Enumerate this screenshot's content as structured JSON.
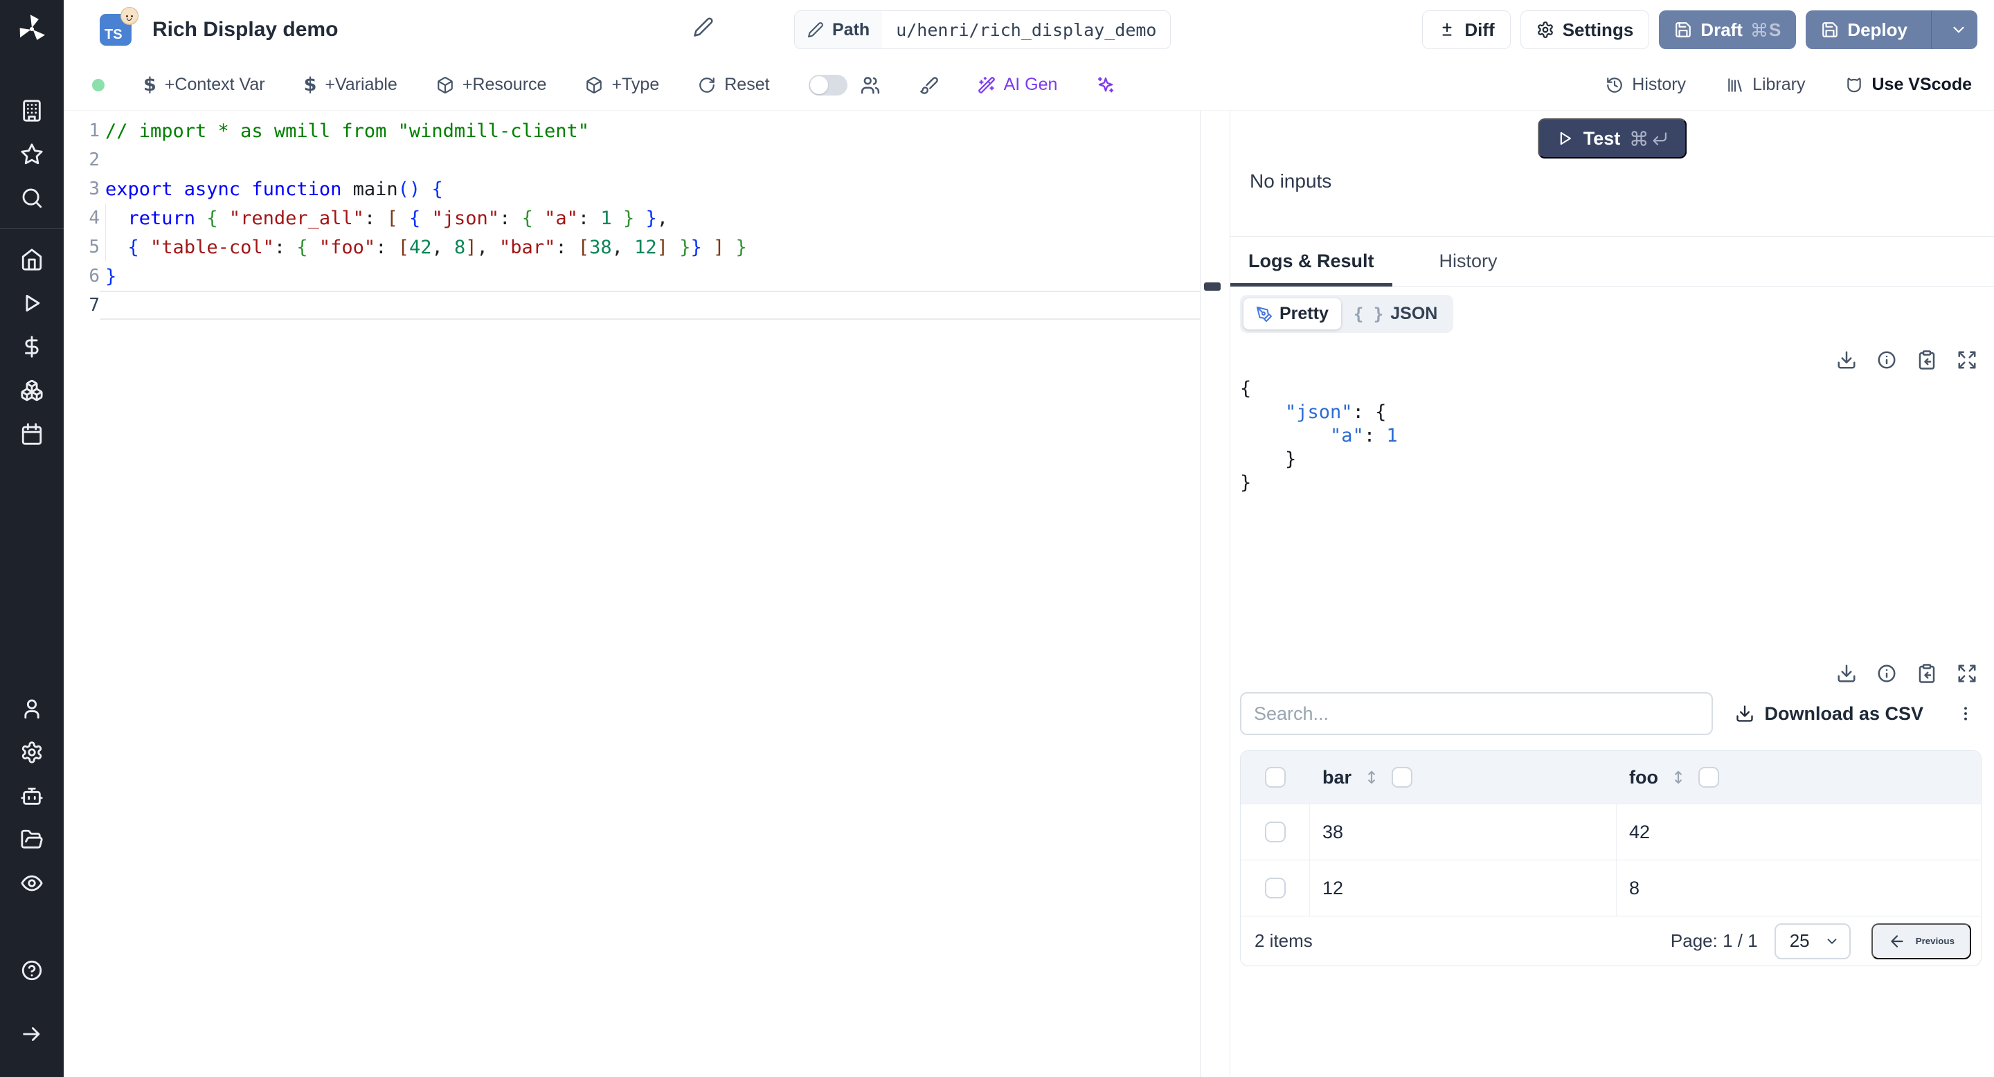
{
  "header": {
    "badge": "TS",
    "title": "Rich Display demo",
    "path_label": "Path",
    "path_value": "u/henri/rich_display_demo",
    "diff": "Diff",
    "settings": "Settings",
    "draft": "Draft",
    "draft_shortcut": "S",
    "deploy": "Deploy"
  },
  "toolbar": {
    "status_dot_color": "#8be0ac",
    "context_var": "+Context Var",
    "variable": "+Variable",
    "resource": "+Resource",
    "type": "+Type",
    "reset": "Reset",
    "ai_gen": "AI Gen",
    "history": "History",
    "library": "Library",
    "use_vscode": "Use VScode"
  },
  "editor": {
    "lines": [
      {
        "n": 1,
        "toks": [
          {
            "c": "c",
            "t": "// import * as wmill from \"windmill-client\""
          }
        ]
      },
      {
        "n": 2,
        "toks": []
      },
      {
        "n": 3,
        "toks": [
          {
            "c": "k",
            "t": "export async function "
          },
          {
            "c": "p",
            "t": "main"
          },
          {
            "c": "b1",
            "t": "()"
          },
          {
            "c": "p",
            "t": " "
          },
          {
            "c": "b1",
            "t": "{"
          }
        ]
      },
      {
        "n": 4,
        "toks": [
          {
            "c": "p",
            "t": "  "
          },
          {
            "c": "k",
            "t": "return"
          },
          {
            "c": "p",
            "t": " "
          },
          {
            "c": "b2",
            "t": "{"
          },
          {
            "c": "p",
            "t": " "
          },
          {
            "c": "s",
            "t": "\"render_all\""
          },
          {
            "c": "p",
            "t": ": "
          },
          {
            "c": "b3",
            "t": "["
          },
          {
            "c": "p",
            "t": " "
          },
          {
            "c": "b1",
            "t": "{"
          },
          {
            "c": "p",
            "t": " "
          },
          {
            "c": "s",
            "t": "\"json\""
          },
          {
            "c": "p",
            "t": ": "
          },
          {
            "c": "b2",
            "t": "{"
          },
          {
            "c": "p",
            "t": " "
          },
          {
            "c": "s",
            "t": "\"a\""
          },
          {
            "c": "p",
            "t": ": "
          },
          {
            "c": "n",
            "t": "1"
          },
          {
            "c": "p",
            "t": " "
          },
          {
            "c": "b2",
            "t": "}"
          },
          {
            "c": "p",
            "t": " "
          },
          {
            "c": "b1",
            "t": "}"
          },
          {
            "c": "p",
            "t": ","
          }
        ]
      },
      {
        "n": 5,
        "toks": [
          {
            "c": "p",
            "t": "  "
          },
          {
            "c": "b1",
            "t": "{"
          },
          {
            "c": "p",
            "t": " "
          },
          {
            "c": "s",
            "t": "\"table-col\""
          },
          {
            "c": "p",
            "t": ": "
          },
          {
            "c": "b2",
            "t": "{"
          },
          {
            "c": "p",
            "t": " "
          },
          {
            "c": "s",
            "t": "\"foo\""
          },
          {
            "c": "p",
            "t": ": "
          },
          {
            "c": "b3",
            "t": "["
          },
          {
            "c": "n",
            "t": "42"
          },
          {
            "c": "p",
            "t": ", "
          },
          {
            "c": "n",
            "t": "8"
          },
          {
            "c": "b3",
            "t": "]"
          },
          {
            "c": "p",
            "t": ", "
          },
          {
            "c": "s",
            "t": "\"bar\""
          },
          {
            "c": "p",
            "t": ": "
          },
          {
            "c": "b3",
            "t": "["
          },
          {
            "c": "n",
            "t": "38"
          },
          {
            "c": "p",
            "t": ", "
          },
          {
            "c": "n",
            "t": "12"
          },
          {
            "c": "b3",
            "t": "]"
          },
          {
            "c": "p",
            "t": " "
          },
          {
            "c": "b2",
            "t": "}"
          },
          {
            "c": "b1",
            "t": "}"
          },
          {
            "c": "p",
            "t": " "
          },
          {
            "c": "b3",
            "t": "]"
          },
          {
            "c": "p",
            "t": " "
          },
          {
            "c": "b2",
            "t": "}"
          }
        ]
      },
      {
        "n": 6,
        "toks": [
          {
            "c": "b1",
            "t": "}"
          }
        ]
      },
      {
        "n": 7,
        "toks": [],
        "active": true
      }
    ]
  },
  "run_panel": {
    "test": "Test",
    "no_inputs": "No inputs",
    "tabs": [
      "Logs & Result",
      "History"
    ],
    "pretty": "Pretty",
    "json_label": "JSON",
    "braces": "{ }"
  },
  "result": {
    "lines": [
      [
        {
          "c": "p",
          "t": "{"
        }
      ],
      [
        {
          "c": "p",
          "t": "    "
        },
        {
          "c": "j",
          "t": "\"json\""
        },
        {
          "c": "p",
          "t": ": {"
        }
      ],
      [
        {
          "c": "p",
          "t": "        "
        },
        {
          "c": "j",
          "t": "\"a\""
        },
        {
          "c": "p",
          "t": ": "
        },
        {
          "c": "j",
          "t": "1"
        }
      ],
      [
        {
          "c": "p",
          "t": "    }"
        }
      ],
      [
        {
          "c": "p",
          "t": "}"
        }
      ]
    ]
  },
  "table": {
    "search_placeholder": "Search...",
    "download_csv": "Download as CSV",
    "columns": [
      "bar",
      "foo"
    ],
    "rows": [
      [
        "38",
        "42"
      ],
      [
        "12",
        "8"
      ]
    ],
    "items": "2 items",
    "page": "Page: 1 / 1",
    "page_size": "25",
    "previous": "Previous"
  },
  "colors": {
    "accent_button": "#6b80a7",
    "test_button": "#3a4465",
    "ai_purple": "#7c3aed",
    "status_green": "#8be0ac",
    "json_blue": "#2b6cd4"
  }
}
